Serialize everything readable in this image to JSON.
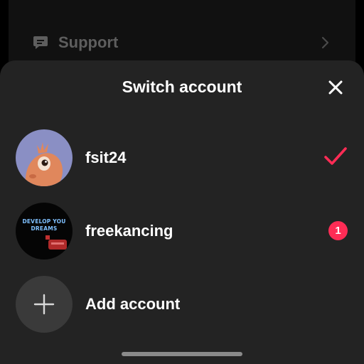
{
  "background": {
    "support_label": "Support"
  },
  "sheet": {
    "title": "Switch account"
  },
  "accounts": [
    {
      "username": "fsit24",
      "active": true
    },
    {
      "username": "freekancing",
      "notification_count": "1",
      "avatar_text_line1": "DEVELOP YOU",
      "avatar_text_line2": "DREAMS"
    }
  ],
  "add_account": {
    "label": "Add account"
  },
  "colors": {
    "accent": "#fe2c55",
    "sheet_bg": "#232323",
    "text_primary": "#ffffff"
  },
  "icons": {
    "support": "chat-bubble-icon",
    "chevron": "chevron-right-icon",
    "close": "close-icon",
    "active": "checkmark-icon",
    "add": "plus-icon"
  }
}
